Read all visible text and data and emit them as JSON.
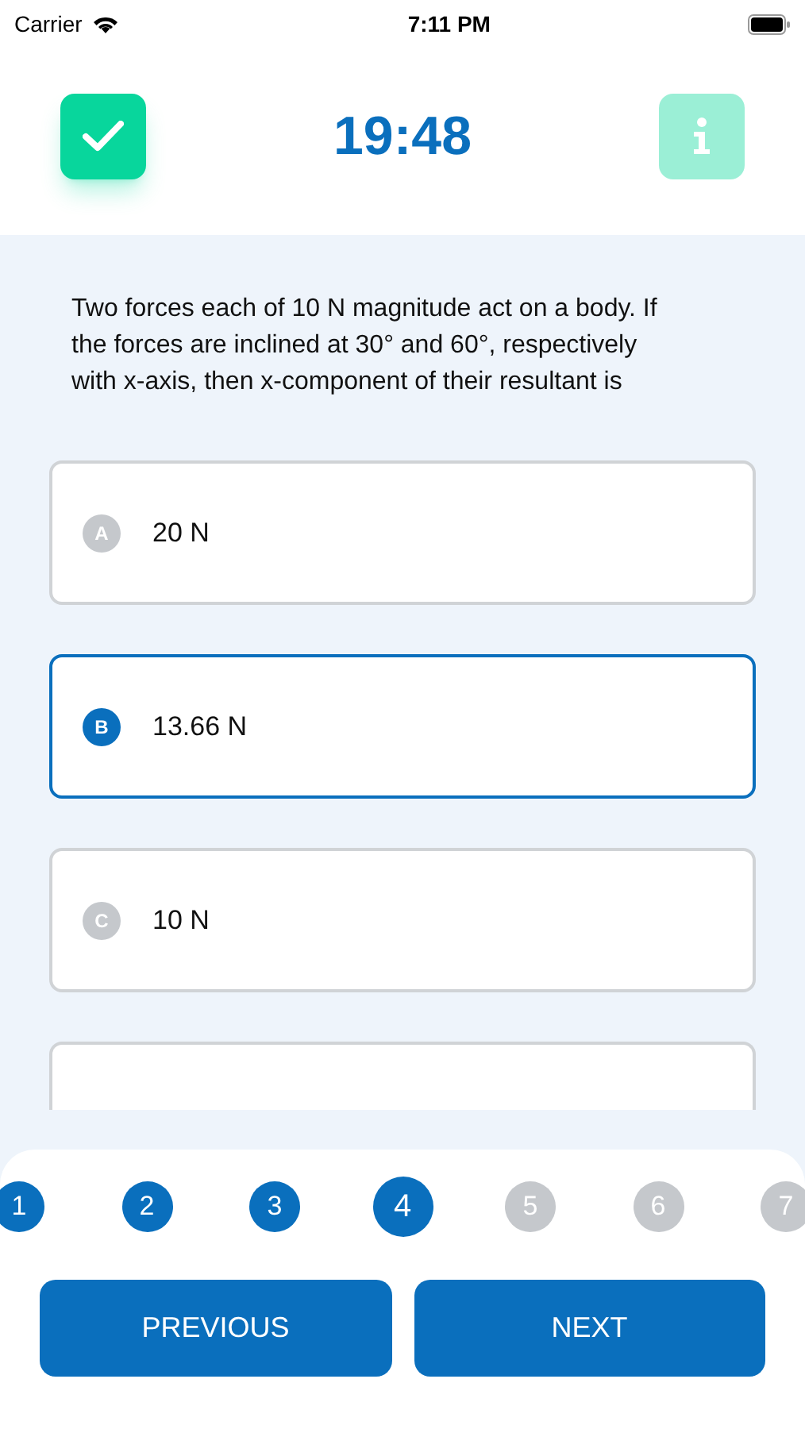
{
  "status_bar": {
    "carrier": "Carrier",
    "time": "7:11 PM"
  },
  "header": {
    "timer": "19:48"
  },
  "question": "Two forces each of 10 N magnitude act on a body. If the forces are inclined at 30° and 60°, respectively with x-axis, then x-component of their resultant is",
  "options": [
    {
      "letter": "A",
      "text": "20 N",
      "selected": false
    },
    {
      "letter": "B",
      "text": "13.66 N",
      "selected": true
    },
    {
      "letter": "C",
      "text": "10 N",
      "selected": false
    }
  ],
  "more_options_below": true,
  "pages": [
    {
      "label": "1",
      "answered": true,
      "selected": false
    },
    {
      "label": "2",
      "answered": true,
      "selected": false
    },
    {
      "label": "3",
      "answered": true,
      "selected": false
    },
    {
      "label": "4",
      "answered": true,
      "selected": true
    },
    {
      "label": "5",
      "answered": false,
      "selected": false
    },
    {
      "label": "6",
      "answered": false,
      "selected": false
    },
    {
      "label": "7",
      "answered": false,
      "selected": false
    }
  ],
  "buttons": {
    "previous": "PREVIOUS",
    "next": "NEXT"
  }
}
